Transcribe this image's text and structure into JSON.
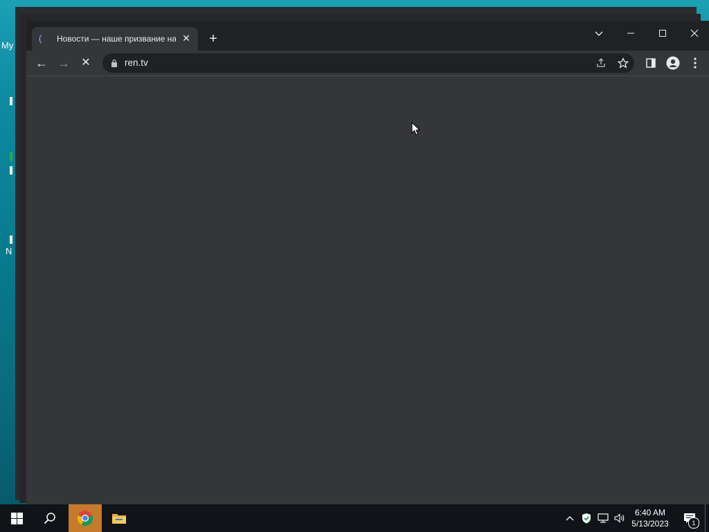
{
  "desktop": {
    "label_top": "My",
    "label_bottom": "N"
  },
  "browser": {
    "tab": {
      "title": "Новости — наше призвание на",
      "close": "✕"
    },
    "new_tab": "+",
    "window_controls": {
      "tab_search": "⌄",
      "minimize": "—",
      "maximize": "☐",
      "close": "✕"
    },
    "toolbar": {
      "back": "←",
      "forward": "→",
      "stop": "✕",
      "url": "ren.tv"
    }
  },
  "taskbar": {
    "clock_time": "6:40 AM",
    "clock_date": "5/13/2023",
    "notification_count": "1"
  }
}
